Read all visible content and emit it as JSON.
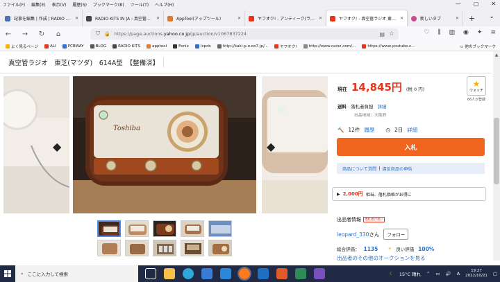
{
  "menu": [
    "ファイル(F)",
    "編集(E)",
    "表示(V)",
    "履歴(S)",
    "ブックマーク(B)",
    "ツール(T)",
    "ヘルプ(H)"
  ],
  "window_controls": [
    "—",
    "▢",
    "✕"
  ],
  "tabs": [
    {
      "title": "記事を編集 | 作成 | RADIO KITS",
      "color": "#4a6fb5",
      "active": false
    },
    {
      "title": "RADIO KITS IN JA : 真空管ラジ",
      "color": "#444444",
      "active": false
    },
    {
      "title": "AppTool(アップツール)",
      "color": "#e07a2e",
      "active": false
    },
    {
      "title": "ヤフオク! - アンティーク(ラジオ オー",
      "color": "#e8341a",
      "active": false
    },
    {
      "title": "ヤフオク! - 真空管ラジオ 東芝(マ",
      "color": "#e8341a",
      "active": true
    },
    {
      "title": "新しいタブ",
      "color": "#d04a8e",
      "active": false
    }
  ],
  "tab_close": "✕",
  "tab_new": "+",
  "tab_overflow": "⌄",
  "url": {
    "prefix": "https://page.auctions.",
    "domain": "yahoo.co.jp",
    "suffix": "/jp/auction/v1067837224"
  },
  "bookmarks": [
    {
      "label": "よく見るページ",
      "color": "#f5b200"
    },
    {
      "label": "ALI",
      "color": "#e8341a"
    },
    {
      "label": "PCBWAY",
      "color": "#2a6fc9"
    },
    {
      "label": "BLOG",
      "color": "#555555"
    },
    {
      "label": "RADIO KITS",
      "color": "#444444"
    },
    {
      "label": "apptool",
      "color": "#e07a2e"
    },
    {
      "label": "Fenix",
      "color": "#333333"
    },
    {
      "label": "lcpcb",
      "color": "#2a6fc9"
    },
    {
      "label": "http://kaki-p.o.oo7.jp/...",
      "color": "#666666"
    },
    {
      "label": "ヤフオク!",
      "color": "#e8341a"
    },
    {
      "label": "http://www.cainz.com/...",
      "color": "#888888"
    },
    {
      "label": "https://www.youtube.c...",
      "color": "#e8341a"
    }
  ],
  "bookmarks_other": "他のブックマーク",
  "page": {
    "title": "真空管ラジオ　東芝(マツダ)　614A型　【整備済】"
  },
  "price": {
    "label": "現在",
    "value": "14,845円",
    "tax": "(税 0 円)"
  },
  "watch": {
    "label": "ウォッチ",
    "count": "66人が登録"
  },
  "shipping": {
    "label": "送料",
    "value": "落札者負担",
    "detail": "詳細",
    "area": "出品地域：大阪府"
  },
  "bids": {
    "count": "12件",
    "history": "履歴",
    "time": "2日",
    "detail": "詳細"
  },
  "bid_button": "入札",
  "inquiry": {
    "question": "商品について質問",
    "sep": "|",
    "report": "違反商品の申告"
  },
  "promo": {
    "amount": "2,000円",
    "text": "相当、落札価格がお得に"
  },
  "seller": {
    "header": "出品者情報",
    "badge": "落札者が高い",
    "name": "leopard_330",
    "suffix": "さん",
    "follow": "フォロー",
    "total_label": "総合評価：",
    "total_value": "1135",
    "good_label": "良い評価",
    "good_value": "100%",
    "other": "出品者のその他のオークションを見る"
  },
  "taskbar": {
    "search_placeholder": "ここに入力して検索",
    "weather": "15°C 晴れ",
    "ime": "A",
    "time": "19:27",
    "date": "2022/10/21"
  },
  "colors": {
    "accent": "#f0641e",
    "price": "#e8341a",
    "link": "#2a6fc9",
    "taskbar": "#202a44"
  }
}
